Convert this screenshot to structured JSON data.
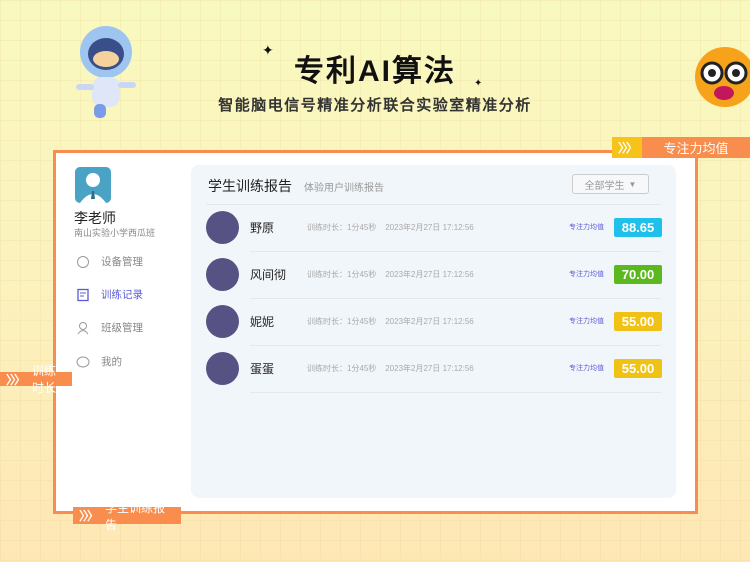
{
  "header": {
    "title": "专利AI算法",
    "subtitle": "智能脑电信号精准分析联合实验室精准分析"
  },
  "tags": {
    "focus": "专注力均值",
    "duration": "训练时长",
    "report": "学生训练报告",
    "chevrons": "〉〉〉"
  },
  "teacher": {
    "name": "李老师",
    "school": "南山实验小学西瓜班"
  },
  "sidebar": {
    "items": [
      {
        "label": "设备管理",
        "icon": "brain-icon"
      },
      {
        "label": "训练记录",
        "icon": "report-icon",
        "active": true
      },
      {
        "label": "班级管理",
        "icon": "class-icon"
      },
      {
        "label": "我的",
        "icon": "profile-icon"
      }
    ]
  },
  "main": {
    "title": "学生训练报告",
    "subtitle": "体验用户训练报告",
    "filter": "全部学生",
    "rows": [
      {
        "name": "野原",
        "meta": "训练时长：1分45秒    2023年2月27日 17:12:56",
        "label": "专注力均值",
        "score": "88.65",
        "color": "#1fc0ea"
      },
      {
        "name": "风间彻",
        "meta": "训练时长：1分45秒    2023年2月27日 17:12:56",
        "label": "专注力均值",
        "score": "70.00",
        "color": "#5cb81f"
      },
      {
        "name": "妮妮",
        "meta": "训练时长：1分45秒    2023年2月27日 17:12:56",
        "label": "专注力均值",
        "score": "55.00",
        "color": "#efc215"
      },
      {
        "name": "蛋蛋",
        "meta": "训练时长：1分45秒    2023年2月27日 17:12:56",
        "label": "专注力均值",
        "score": "55.00",
        "color": "#efc215"
      }
    ]
  }
}
